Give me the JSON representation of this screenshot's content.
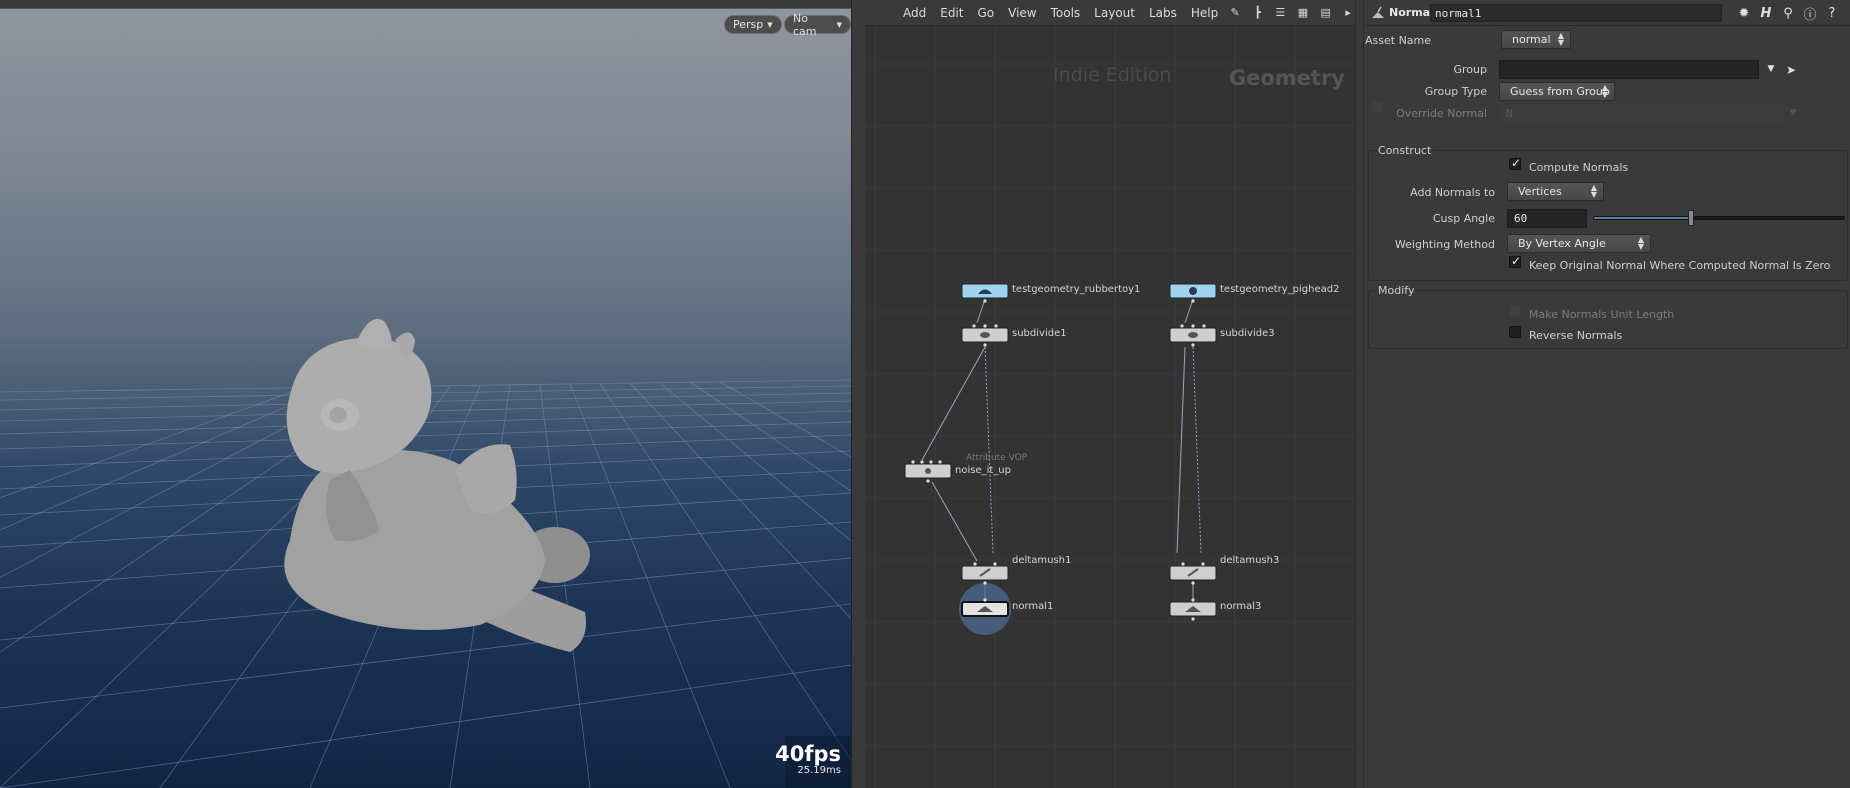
{
  "viewport": {
    "camera_persp": "Persp",
    "camera_nocam": "No cam",
    "fps": "40fps",
    "frame_time": "25.19ms"
  },
  "network": {
    "menu": [
      "Add",
      "Edit",
      "Go",
      "View",
      "Tools",
      "Layout",
      "Labs",
      "Help"
    ],
    "edition": "Indie Edition",
    "context": "Geometry",
    "nodes": {
      "rubbertoy": "testgeometry_rubbertoy1",
      "pighead": "testgeometry_pighead2",
      "subdivide1": "subdivide1",
      "subdivide3": "subdivide3",
      "noise": "noise_it_up",
      "noise_sub": "Attribute VOP",
      "deltamush1": "deltamush1",
      "deltamush3": "deltamush3",
      "normal1": "normal1",
      "normal3": "normal3"
    }
  },
  "params": {
    "type": "Normal",
    "node_name": "normal1",
    "asset_name_label": "Asset Name",
    "asset_name_value": "normal",
    "group_label": "Group",
    "group_value": "",
    "group_type_label": "Group Type",
    "group_type_value": "Guess from Group",
    "override_normal_label": "Override Normal",
    "override_normal_value": "N",
    "construct_title": "Construct",
    "compute_normals_label": "Compute Normals",
    "add_normals_to_label": "Add Normals to",
    "add_normals_to_value": "Vertices",
    "cusp_angle_label": "Cusp Angle",
    "cusp_angle_value": "60",
    "cusp_angle_fraction": 0.39,
    "weighting_method_label": "Weighting Method",
    "weighting_method_value": "By Vertex Angle",
    "keep_original_label": "Keep Original Normal Where Computed Normal Is Zero",
    "modify_title": "Modify",
    "make_unit_label": "Make Normals Unit Length",
    "reverse_normals_label": "Reverse Normals"
  }
}
